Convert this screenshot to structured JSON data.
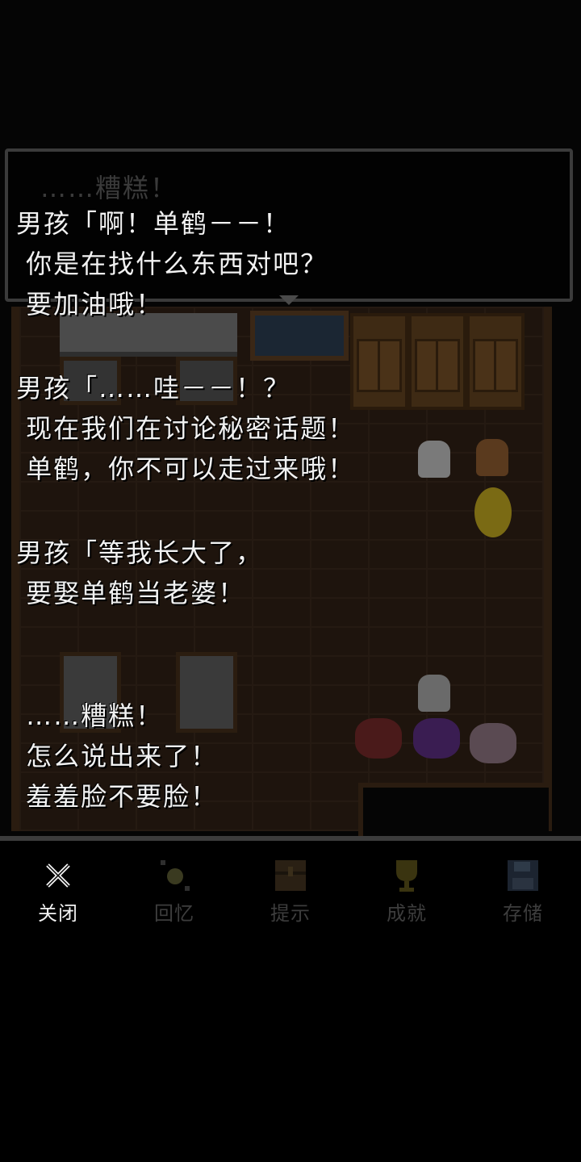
{
  "dialog": {
    "ghost_text": "……糟糕！"
  },
  "backlog": [
    {
      "lines": [
        "男孩「啊！单鹤－－！",
        " 你是在找什么东西对吧？",
        " 要加油哦！"
      ]
    },
    {
      "lines": [
        "男孩「……哇－－！？",
        " 现在我们在讨论秘密话题！",
        " 单鹤，你不可以走过来哦！"
      ]
    },
    {
      "lines": [
        "男孩「等我长大了，",
        " 要娶单鹤当老婆！"
      ]
    },
    {
      "lines": [
        " ……糟糕！",
        " 怎么说出来了！",
        " 羞羞脸不要脸！"
      ]
    }
  ],
  "menu": [
    {
      "label": "关闭",
      "icon": "close-icon",
      "active": true
    },
    {
      "label": "回忆",
      "icon": "memory-icon",
      "active": false
    },
    {
      "label": "提示",
      "icon": "hint-icon",
      "active": false
    },
    {
      "label": "成就",
      "icon": "trophy-icon",
      "active": false
    },
    {
      "label": "存储",
      "icon": "save-icon",
      "active": false
    }
  ],
  "colors": {
    "text": "#f2f2f2",
    "dim_text": "#3d3d3d",
    "background": "#000000"
  }
}
